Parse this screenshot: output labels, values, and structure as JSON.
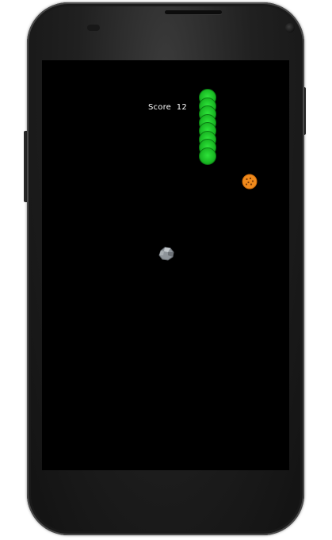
{
  "app": {
    "screen_background": "#000000"
  },
  "hud": {
    "score_label": "Score",
    "score_value": "12",
    "score_text": "Score  12"
  },
  "snake": {
    "segment_count": 8,
    "color": "#1fc42a"
  },
  "items": {
    "food": {
      "kind": "cookie",
      "icon": "cookie-icon",
      "color": "#f08a1c"
    },
    "obstacle": {
      "kind": "rock",
      "icon": "rock-icon",
      "color": "#8e949a"
    }
  }
}
